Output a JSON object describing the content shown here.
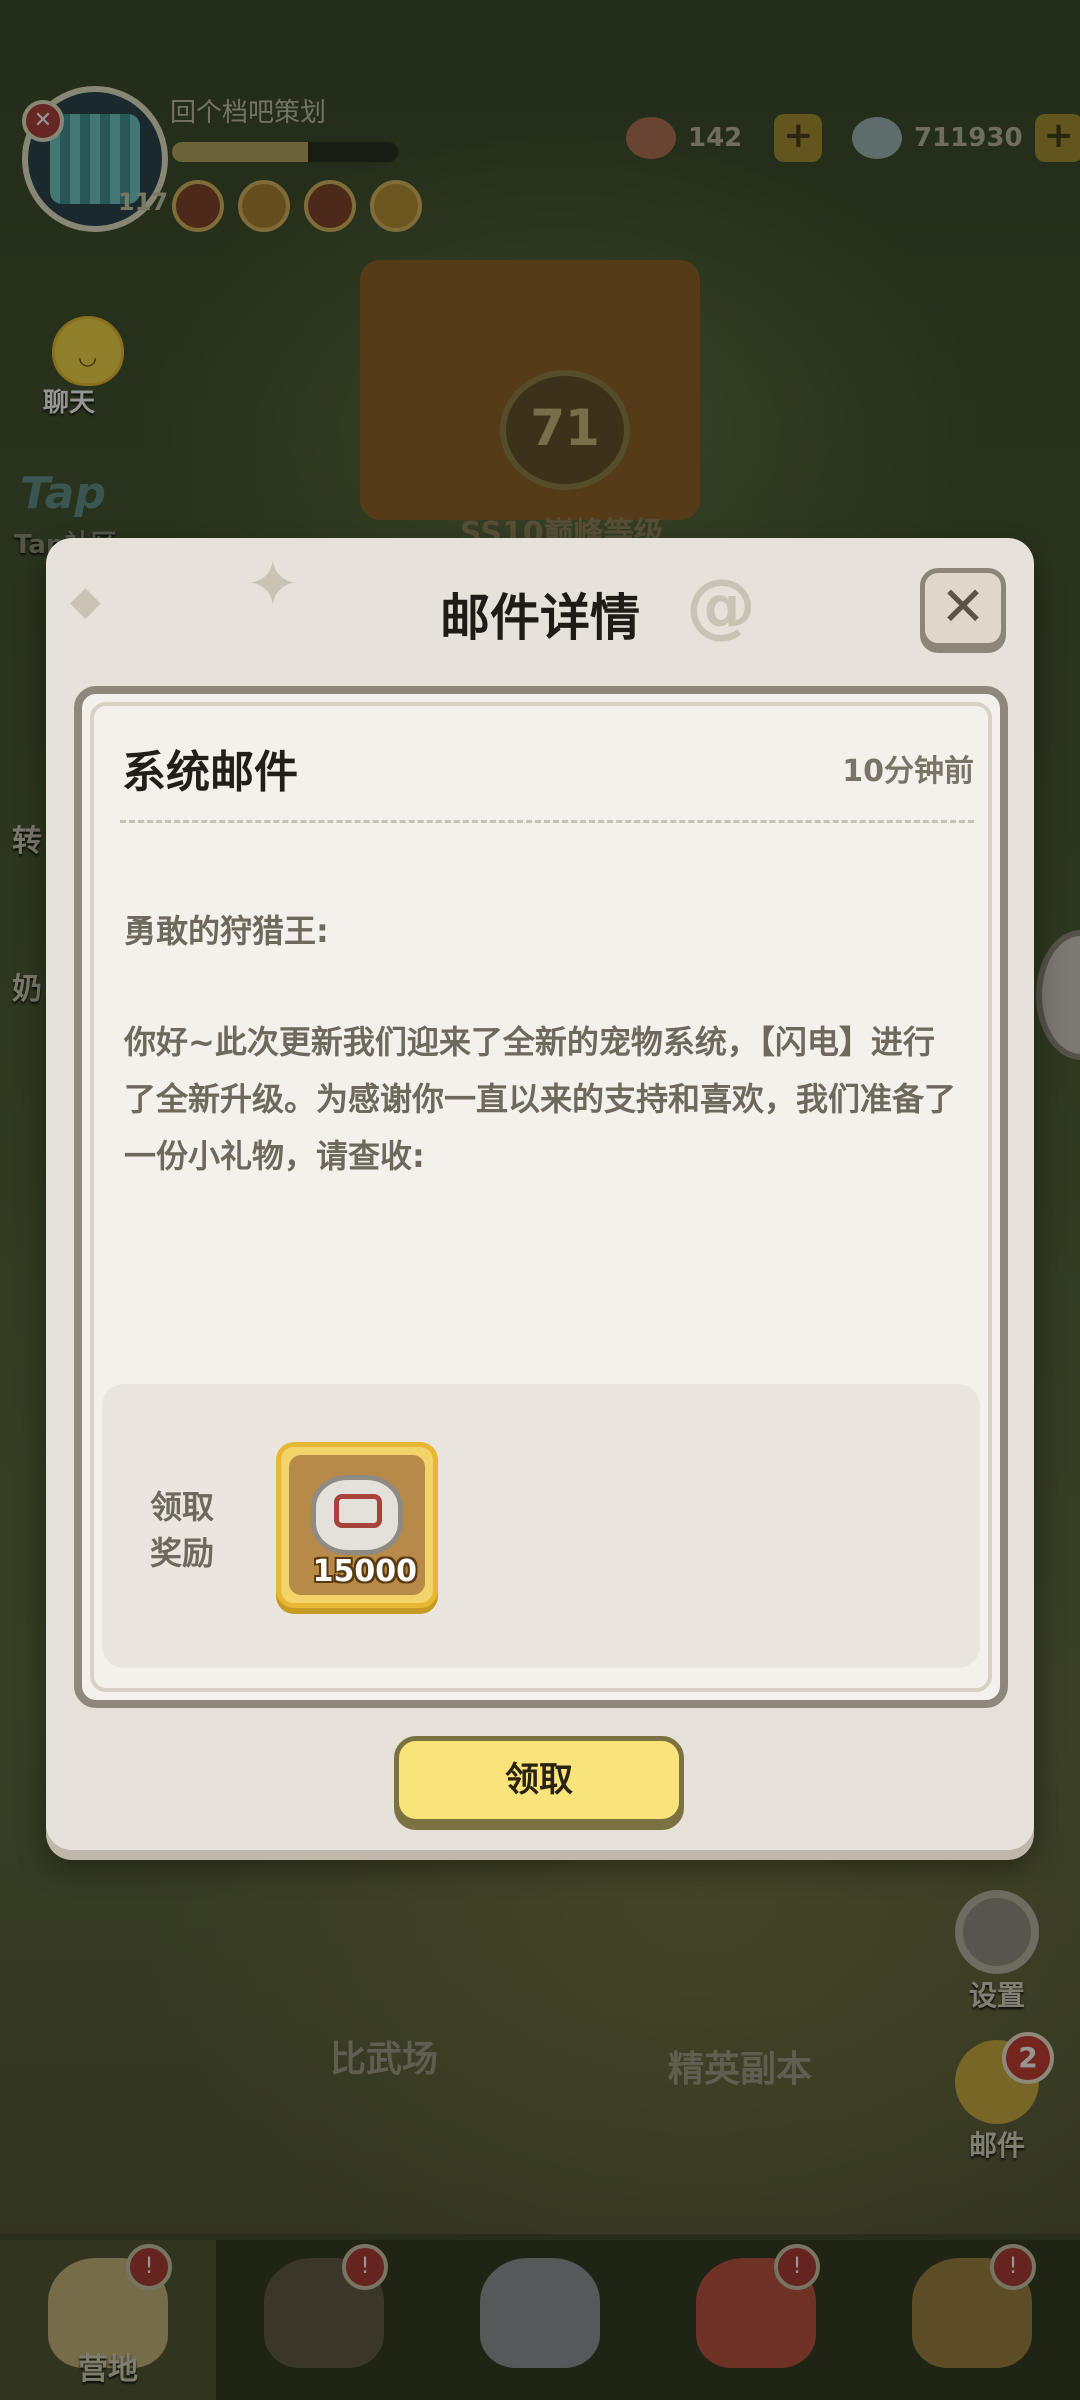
{
  "player": {
    "name": "回个档吧策划",
    "level": "117",
    "exp_fraction": 0.6
  },
  "resources": [
    {
      "icon": "meat-icon",
      "value": "142"
    },
    {
      "icon": "stone-shell-icon",
      "value": "711930"
    }
  ],
  "side_buttons": {
    "chat": "聊天",
    "tap": "Tap",
    "tap_partial": "Tap社区",
    "left_partial_1": "转",
    "left_partial_2": "奶"
  },
  "season": {
    "level": "71",
    "label": "SS10巅峰等级"
  },
  "map_labels": {
    "arena": "比武场",
    "elite": "精英副本"
  },
  "right_buttons": {
    "settings": "设置",
    "mail": "邮件",
    "mail_count": "2"
  },
  "bottom_nav": {
    "items": [
      {
        "label": "营地",
        "active": true
      },
      {
        "label": "",
        "active": false
      },
      {
        "label": "",
        "active": false
      },
      {
        "label": "",
        "active": false
      },
      {
        "label": "",
        "active": false
      }
    ]
  },
  "modal": {
    "title": "邮件详情",
    "close_icon": "close-icon",
    "mail_type": "系统邮件",
    "time": "10分钟前",
    "greeting": "勇敢的狩猎王:",
    "body": "你好~此次更新我们迎来了全新的宠物系统，【闪电】进行了全新升级。为感谢你一直以来的支持和喜欢，我们准备了一份小礼物，请查收:",
    "reward_label": "领取奖励",
    "reward_item_qty": "15000",
    "claim_button": "领取"
  }
}
